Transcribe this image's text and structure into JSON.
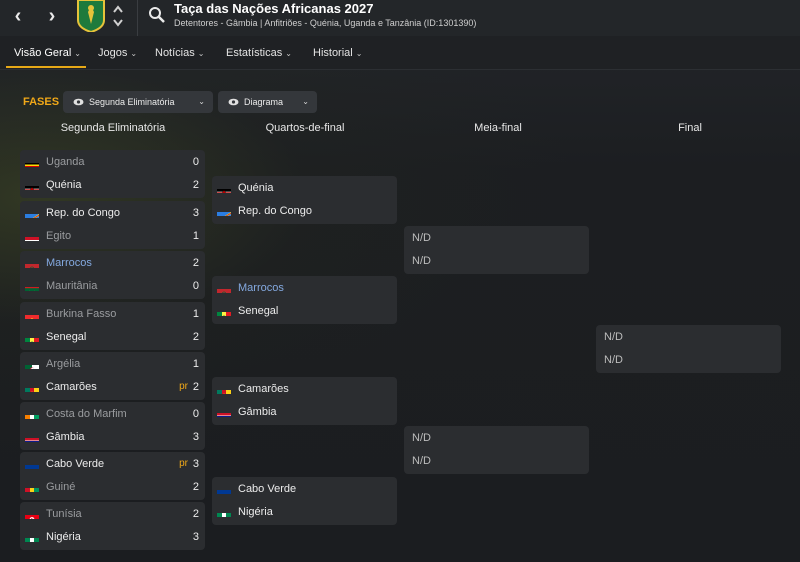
{
  "header": {
    "back_label": "‹",
    "forward_label": "›",
    "title": "Taça das Nações Africanas 2027",
    "subtitle": "Detentores - Gâmbia | Anfitriões - Quénia, Uganda e Tanzânia (ID:1301390)"
  },
  "menu": {
    "items": [
      {
        "label": "Visão Geral"
      },
      {
        "label": "Jogos"
      },
      {
        "label": "Notícias"
      },
      {
        "label": "Estatísticas"
      },
      {
        "label": "Historial"
      }
    ],
    "chevron": "⌄"
  },
  "phases": {
    "label": "FASES",
    "stage_select": "Segunda Eliminatória",
    "view_select": "Diagrama"
  },
  "columns": [
    "Segunda Eliminatória",
    "Quartos-de-final",
    "Meia-final",
    "Final"
  ],
  "round1": [
    {
      "home": {
        "name": "Uganda",
        "score": "0",
        "flag": "uganda",
        "loser": true
      },
      "away": {
        "name": "Quénia",
        "score": "2",
        "flag": "kenya",
        "loser": false
      }
    },
    {
      "home": {
        "name": "Rep. do Congo",
        "score": "3",
        "flag": "drc",
        "loser": false
      },
      "away": {
        "name": "Egito",
        "score": "1",
        "flag": "egypt",
        "loser": true
      }
    },
    {
      "home": {
        "name": "Marrocos",
        "score": "2",
        "flag": "morocco",
        "loser": false,
        "link": true
      },
      "away": {
        "name": "Mauritânia",
        "score": "0",
        "flag": "mauritania",
        "loser": true
      }
    },
    {
      "home": {
        "name": "Burkina Fasso",
        "score": "1",
        "flag": "burkina",
        "loser": true
      },
      "away": {
        "name": "Senegal",
        "score": "2",
        "flag": "senegal",
        "loser": false
      }
    },
    {
      "home": {
        "name": "Argélia",
        "score": "1",
        "flag": "algeria",
        "loser": true
      },
      "away": {
        "name": "Camarões",
        "score": "2",
        "flag": "cameroon",
        "loser": false,
        "pr": "pr"
      }
    },
    {
      "home": {
        "name": "Costa do Marfim",
        "score": "0",
        "flag": "ivorycoast",
        "loser": true
      },
      "away": {
        "name": "Gâmbia",
        "score": "3",
        "flag": "gambia",
        "loser": false
      }
    },
    {
      "home": {
        "name": "Cabo Verde",
        "score": "3",
        "flag": "capeverde",
        "loser": false,
        "pr": "pr"
      },
      "away": {
        "name": "Guiné",
        "score": "2",
        "flag": "guinea",
        "loser": true
      }
    },
    {
      "home": {
        "name": "Tunísia",
        "score": "2",
        "flag": "tunisia",
        "loser": true
      },
      "away": {
        "name": "Nigéria",
        "score": "3",
        "flag": "nigeria",
        "loser": false
      }
    }
  ],
  "quarters": [
    {
      "home": {
        "name": "Quénia",
        "flag": "kenya"
      },
      "away": {
        "name": "Rep. do Congo",
        "flag": "drc"
      }
    },
    {
      "home": {
        "name": "Marrocos",
        "flag": "morocco",
        "link": true
      },
      "away": {
        "name": "Senegal",
        "flag": "senegal"
      }
    },
    {
      "home": {
        "name": "Camarões",
        "flag": "cameroon"
      },
      "away": {
        "name": "Gâmbia",
        "flag": "gambia"
      }
    },
    {
      "home": {
        "name": "Cabo Verde",
        "flag": "capeverde"
      },
      "away": {
        "name": "Nigéria",
        "flag": "nigeria"
      }
    }
  ],
  "semis": [
    {
      "home": "N/D",
      "away": "N/D"
    },
    {
      "home": "N/D",
      "away": "N/D"
    }
  ],
  "final": {
    "home": "N/D",
    "away": "N/D"
  }
}
